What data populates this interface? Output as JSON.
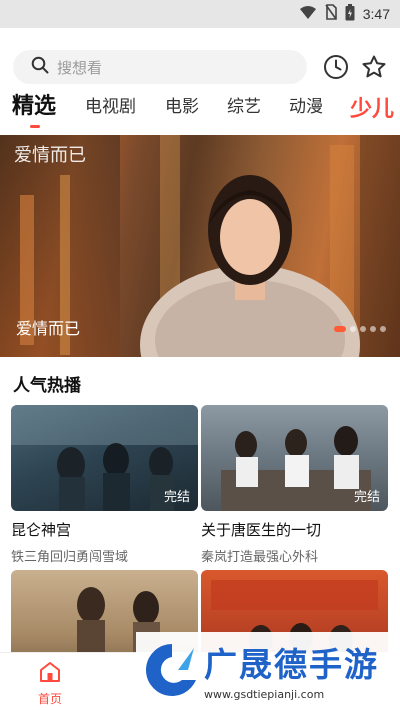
{
  "status_bar": {
    "time": "3:47",
    "icons": [
      "wifi-icon",
      "no-sim-icon",
      "battery-icon"
    ]
  },
  "header": {
    "search_placeholder": "搜想看",
    "icons": [
      "search-icon",
      "history-icon",
      "favorites-star-icon"
    ]
  },
  "tabs": [
    {
      "label": "精选",
      "active": true
    },
    {
      "label": "电视剧",
      "active": false
    },
    {
      "label": "电影",
      "active": false
    },
    {
      "label": "综艺",
      "active": false
    },
    {
      "label": "动漫",
      "active": false
    },
    {
      "label": "少儿",
      "active": false
    }
  ],
  "banner": {
    "title": "爱情而已",
    "logo_text": "爱情而已",
    "slide_count": 5,
    "active_slide": 1
  },
  "section": {
    "title": "人气热播"
  },
  "cards": [
    {
      "title": "昆仑神宫",
      "subtitle": "铁三角回归勇闯雪域",
      "badge": "完结"
    },
    {
      "title": "关于唐医生的一切",
      "subtitle": "秦岚打造最强心外科",
      "badge": "完结"
    },
    {
      "title": "",
      "subtitle": "",
      "badge": ""
    },
    {
      "title": "",
      "subtitle": "",
      "badge": ""
    }
  ],
  "bottom_nav": {
    "home_label": "首页"
  },
  "watermark": {
    "name": "广晟德手游",
    "url": "www.gsdtiepianji.com"
  },
  "colors": {
    "accent": "#ff4a3d",
    "watermark_blue": "#1f63c9"
  }
}
